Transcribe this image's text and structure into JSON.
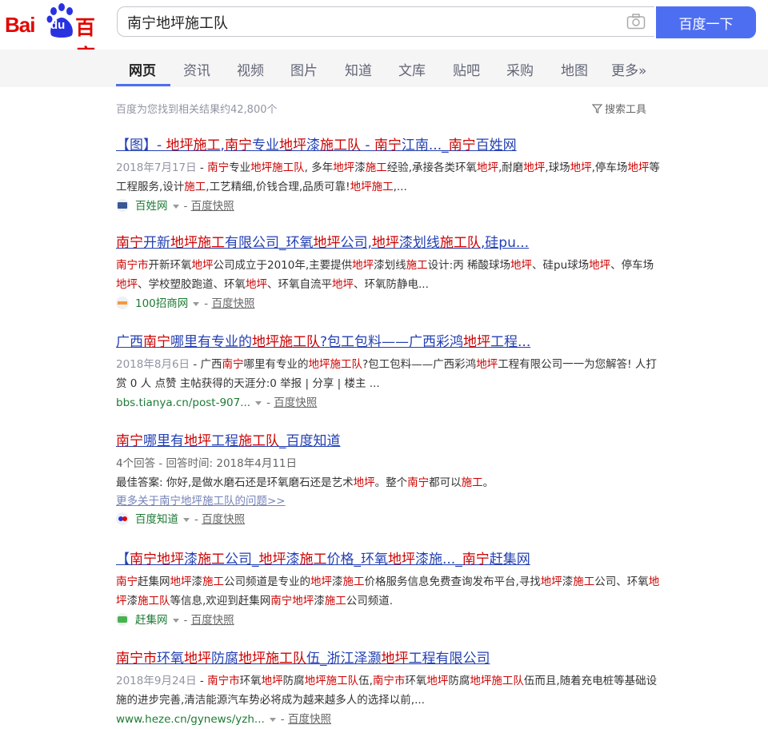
{
  "search": {
    "query": "南宁地坪施工队",
    "button_label": "百度一下"
  },
  "logo": {
    "text_bai": "Bai",
    "text_du": "du",
    "text_cn": "百度"
  },
  "tabs": [
    {
      "label": "网页"
    },
    {
      "label": "资讯"
    },
    {
      "label": "视频"
    },
    {
      "label": "图片"
    },
    {
      "label": "知道"
    },
    {
      "label": "文库"
    },
    {
      "label": "贴吧"
    },
    {
      "label": "采购"
    },
    {
      "label": "地图"
    },
    {
      "label": "更多»"
    }
  ],
  "results_count": "百度为您找到相关结果约42,800个",
  "search_tools": "搜索工具",
  "colors": {
    "accent": "#4e6ef2",
    "link": "#2440b3",
    "highlight": "#cc0000",
    "site_green": "#1e7b35"
  },
  "results": [
    {
      "title": "【图】- 地坪施工,南宁专业地坪漆施工队 - 南宁江南..._南宁百姓网",
      "date": "2018年7月17日",
      "snippet": "南宁专业地坪施工队, 多年地坪漆施工经验,承接各类环氧地坪,耐磨地坪,球场地坪,停车场地坪等工程服务,设计施工,工艺精细,价钱合理,品质可靠!地坪施工,...",
      "site": "百姓网",
      "favicon": "baixing-icon",
      "cache": "百度快照"
    },
    {
      "title": "南宁开新地坪施工有限公司_环氧地坪公司,地坪漆划线施工队,硅pu...",
      "snippet": "南宁市开新环氧地坪公司成立于2010年,主要提供地坪漆划线施工设计:丙 稀酸球场地坪、硅pu球场地坪、停车场地坪、学校塑胶跑道、环氧地坪、环氧自流平地坪、环氧防静电...",
      "site": "100招商网",
      "favicon": "100zhaoshang-icon",
      "cache": "百度快照"
    },
    {
      "title": "广西南宁哪里有专业的地坪施工队?包工包料——广西彩鸿地坪工程...",
      "date": "2018年8月6日",
      "snippet": "广西南宁哪里有专业的地坪施工队?包工包料——广西彩鸿地坪工程有限公司一一为您解答! 人打赏 0 人 点赞 主帖获得的天涯分:0 举报 | 分享 | 楼主 ...",
      "site": "bbs.tianya.cn/post-907...",
      "cache": "百度快照"
    },
    {
      "title": "南宁哪里有地坪工程施工队_百度知道",
      "answers": "4个回答 - 回答时间: 2018年4月11日",
      "snippet": "最佳答案: 你好,是做水磨石还是环氧磨石还是艺术地坪。整个南宁都可以施工。",
      "more": "更多关于南宁地坪施工队的问题>>",
      "site": "百度知道",
      "favicon": "zhidao-icon",
      "cache": "百度快照"
    },
    {
      "title": "【南宁地坪漆施工公司_地坪漆施工价格_环氧地坪漆施..._南宁赶集网",
      "snippet": "南宁赶集网地坪漆施工公司频道是专业的地坪漆施工价格服务信息免费查询发布平台,寻找地坪漆施工公司、环氧地坪漆施工队等信息,欢迎到赶集网南宁地坪漆施工公司频道.",
      "site": "赶集网",
      "favicon": "ganji-icon",
      "cache": "百度快照"
    },
    {
      "title": "南宁市环氧地坪防腐地坪施工队伍_浙江泽灏地坪工程有限公司",
      "date": "2018年9月24日",
      "snippet": "南宁市环氧地坪防腐地坪施工队伍,南宁市环氧地坪防腐地坪施工队伍而且,随着充电桩等基础设施的进步完善,清洁能源汽车势必将成为越来越多人的选择以前,...",
      "site": "www.heze.cn/gynews/yzh...",
      "cache": "百度快照"
    }
  ]
}
